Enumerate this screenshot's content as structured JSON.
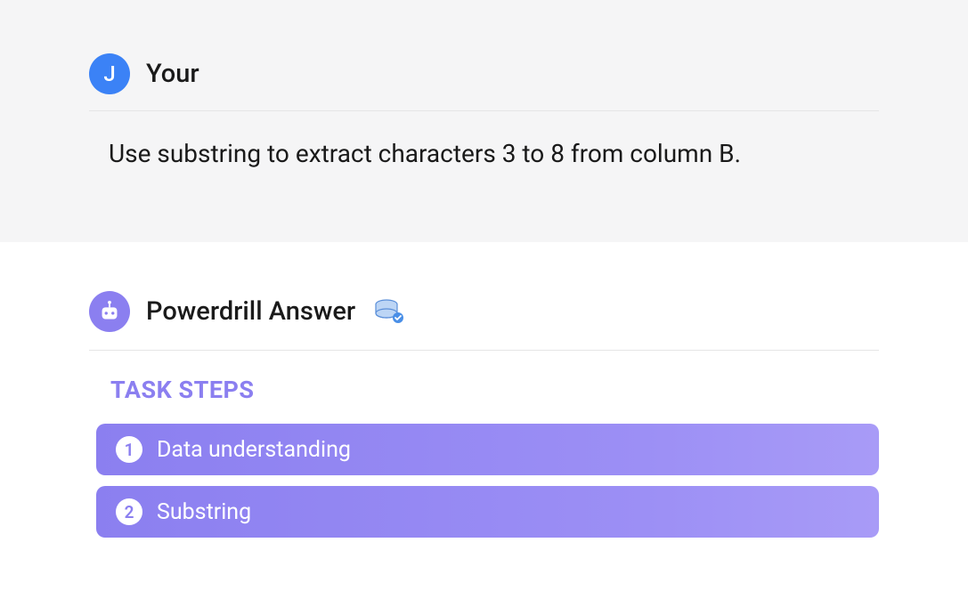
{
  "user": {
    "avatar_letter": "J",
    "name": "Your",
    "message": "Use substring to extract characters 3 to 8 from column B."
  },
  "answer": {
    "title": "Powerdrill Answer",
    "task_steps_header": "TASK STEPS",
    "steps": [
      {
        "number": "1",
        "label": "Data understanding"
      },
      {
        "number": "2",
        "label": "Substring"
      }
    ]
  }
}
